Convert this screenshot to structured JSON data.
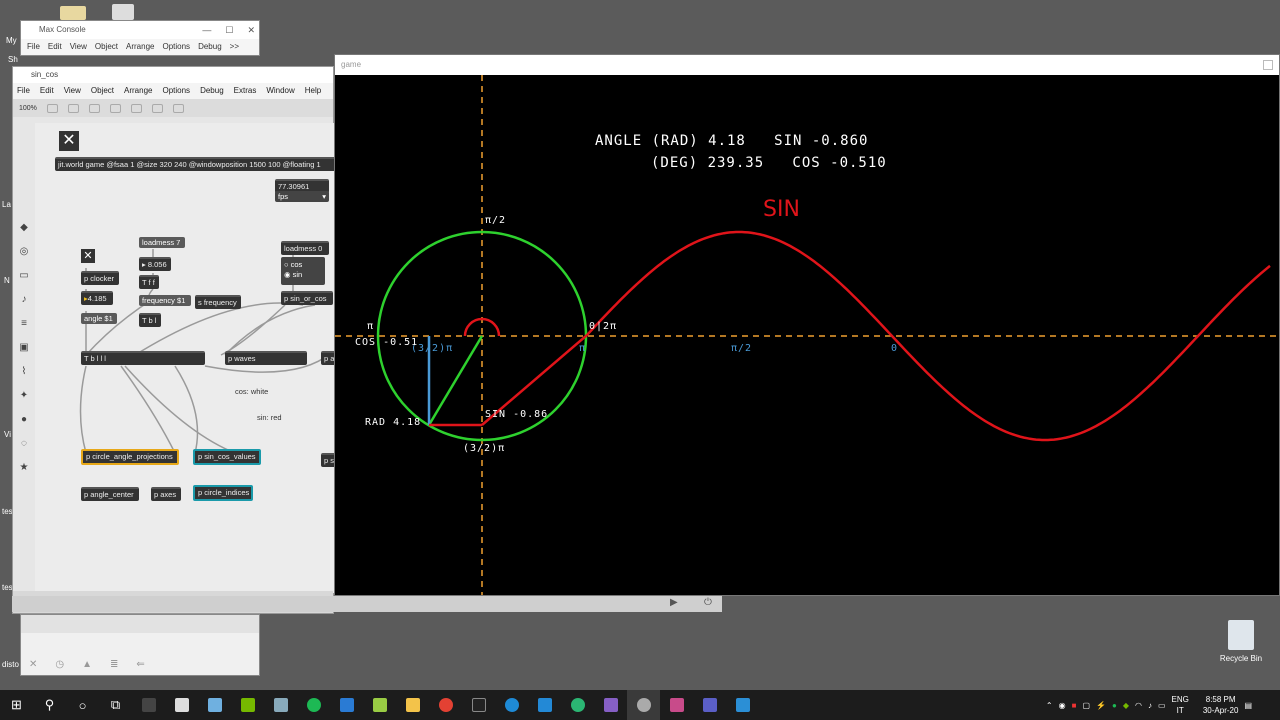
{
  "max_console": {
    "title": "Max Console",
    "menu": [
      "File",
      "Edit",
      "View",
      "Object",
      "Arrange",
      "Options",
      "Debug",
      ">>"
    ]
  },
  "patcher": {
    "title": "sin_cos",
    "menu": [
      "File",
      "Edit",
      "View",
      "Object",
      "Arrange",
      "Options",
      "Debug",
      "Extras",
      "Window",
      "Help"
    ],
    "zoom": "100%",
    "objects": {
      "jit_world": "jit.world game @fsaa 1 @size 320 240 @windowposition 1500 100 @floating 1",
      "fps_value": "77.30961",
      "fps_label": "fps",
      "loadmess7": "loadmess 7",
      "freq_number": "8.056",
      "tfl": "T f f",
      "frequency_msg": "frequency $1",
      "s_frequency": "s frequency",
      "tbl": "T b l",
      "loadmess0": "loadmess 0",
      "radio_cos": "cos",
      "radio_sin": "sin",
      "p_sin_or_cos": "p sin_or_cos",
      "p_clocker": "p clocker",
      "angle_number": "4.185",
      "angle_msg": "angle $1",
      "tblll": "T b l l l",
      "p_waves": "p waves",
      "p_a": "p a",
      "comment_cos": "cos: white",
      "comment_sin": "sin: red",
      "p_circle_angle_projections": "p circle_angle_projections",
      "p_sin_cos_values": "p sin_cos_values",
      "p_si": "p si",
      "p_angle_center": "p angle_center",
      "p_axes": "p axes",
      "p_circle_indices": "p circle_indices"
    }
  },
  "game": {
    "title": "game",
    "line1": "ANGLE (RAD) 4.18   SIN -0.860",
    "line2": "(DEG) 239.35   COS -0.510",
    "sin_title": "SIN",
    "labels": {
      "pi_half": "π/2",
      "pi": "π",
      "zero_2pi": "0|2π",
      "three_half_pi": "(3/2)π",
      "cos_value": "COS -0.51",
      "sin_value": "SIN -0.86",
      "rad_value": "RAD 4.18",
      "axis_pi": "π",
      "axis_pi_half": "π/2",
      "axis_zero": "0"
    },
    "colors": {
      "circle": "#2ed12e",
      "sin_wave": "#e0141a",
      "axis": "#f0a030",
      "cos_line": "#4a9ad6"
    }
  },
  "desktop": {
    "recycle_bin": "Recycle Bin",
    "side_labels": [
      "My",
      "Sh",
      "La",
      "N",
      "Vi",
      "tes",
      "tes",
      "disto"
    ]
  },
  "taskbar": {
    "lang1": "ENG",
    "lang2": "IT",
    "time": "8:58 PM",
    "date": "30-Apr-20"
  }
}
